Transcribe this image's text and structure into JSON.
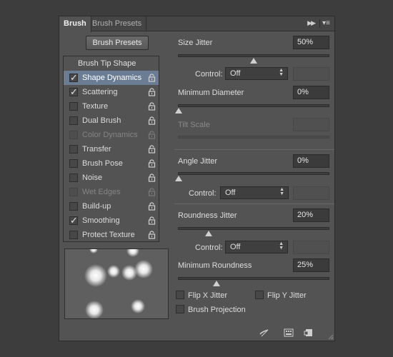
{
  "tabs": [
    "Brush",
    "Brush Presets"
  ],
  "icons": {
    "panel_menu": "panel-menu-icon",
    "collapse": "double-arrow-icon",
    "lock": "lock-icon"
  },
  "presets_button": "Brush Presets",
  "options_header": "Brush Tip Shape",
  "options": [
    {
      "label": "Shape Dynamics",
      "checked": true,
      "selected": true,
      "disabled": false
    },
    {
      "label": "Scattering",
      "checked": true,
      "selected": false,
      "disabled": false
    },
    {
      "label": "Texture",
      "checked": false,
      "selected": false,
      "disabled": false
    },
    {
      "label": "Dual Brush",
      "checked": false,
      "selected": false,
      "disabled": false
    },
    {
      "label": "Color Dynamics",
      "checked": false,
      "selected": false,
      "disabled": true
    },
    {
      "label": "Transfer",
      "checked": false,
      "selected": false,
      "disabled": false
    },
    {
      "label": "Brush Pose",
      "checked": false,
      "selected": false,
      "disabled": false
    },
    {
      "label": "Noise",
      "checked": false,
      "selected": false,
      "disabled": false
    },
    {
      "label": "Wet Edges",
      "checked": false,
      "selected": false,
      "disabled": true
    },
    {
      "label": "Build-up",
      "checked": false,
      "selected": false,
      "disabled": false
    },
    {
      "label": "Smoothing",
      "checked": true,
      "selected": false,
      "disabled": false
    },
    {
      "label": "Protect Texture",
      "checked": false,
      "selected": false,
      "disabled": false
    }
  ],
  "settings": {
    "size_jitter": {
      "label": "Size Jitter",
      "value": "50%",
      "level": 0.5
    },
    "size_control": {
      "label": "Control:",
      "value": "Off"
    },
    "min_diameter": {
      "label": "Minimum Diameter",
      "value": "0%",
      "level": 0.0
    },
    "tilt_scale": {
      "label": "Tilt Scale",
      "value": ""
    },
    "angle_jitter": {
      "label": "Angle Jitter",
      "value": "0%",
      "level": 0.0
    },
    "angle_control": {
      "label": "Control:",
      "value": "Off"
    },
    "roundness_jitter": {
      "label": "Roundness Jitter",
      "value": "20%",
      "level": 0.2
    },
    "roundness_control": {
      "label": "Control:",
      "value": "Off"
    },
    "min_roundness": {
      "label": "Minimum Roundness",
      "value": "25%",
      "level": 0.25
    }
  },
  "checks": {
    "flip_x": "Flip X Jitter",
    "flip_y": "Flip Y Jitter",
    "projection": "Brush Projection"
  },
  "colors": {
    "selected_row": "#6b7d95",
    "panel": "#535353",
    "background": "#3d3d3d"
  }
}
